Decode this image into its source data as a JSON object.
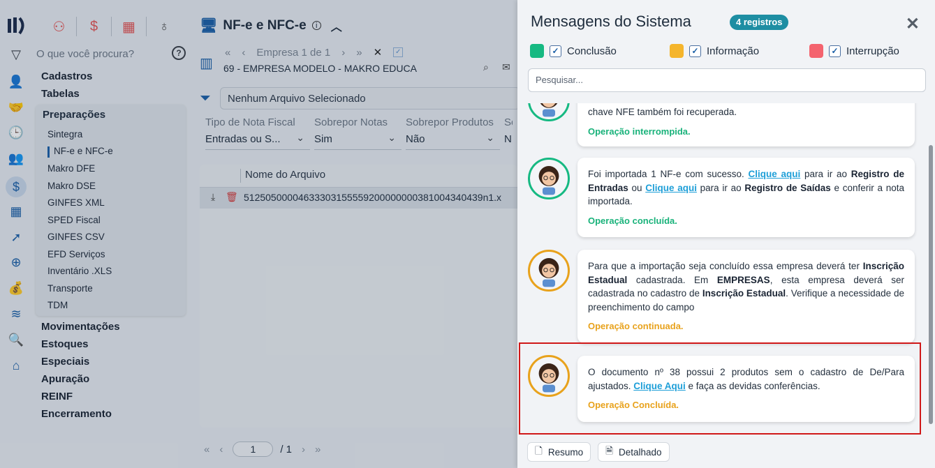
{
  "sidebar": {
    "search_placeholder": "O que você procura?",
    "help": "?",
    "menu_top": [
      "Cadastros",
      "Tabelas"
    ],
    "submenu": {
      "header": "Preparações",
      "items": [
        "Sintegra",
        "NF-e e NFC-e",
        "Makro DFE",
        "Makro DSE",
        "GINFES XML",
        "SPED Fiscal",
        "GINFES CSV",
        "EFD Serviços",
        "Inventário .XLS",
        "Transporte",
        "TDM"
      ],
      "selected": "NF-e e NFC-e"
    },
    "menu_bottom": [
      "Movimentações",
      "Estoques",
      "Especiais",
      "Apuração",
      "REINF",
      "Encerramento"
    ]
  },
  "main": {
    "title": "NF-e e NFC-e",
    "nav_empresa": "Empresa 1 de 1",
    "empresa": "69 - EMPRESA MODELO - MAKRO EDUCA",
    "file_selector": "Nenhum Arquivo Selecionado",
    "fields": [
      {
        "label": "Tipo de Nota Fiscal",
        "value": "Entradas ou S..."
      },
      {
        "label": "Sobrepor Notas",
        "value": "Sim"
      },
      {
        "label": "Sobrepor Produtos",
        "value": "Não"
      },
      {
        "label": "So",
        "value": "N"
      }
    ],
    "grid_header": "Nome do Arquivo",
    "grid_row": "51250500004633303155559200000000381004340439n1.x",
    "pager_page": "1",
    "pager_total": "/ 1"
  },
  "panel": {
    "title": "Mensagens do Sistema",
    "badge": "4 registros",
    "legend": [
      {
        "label": "Conclusão",
        "color": "#16b982"
      },
      {
        "label": "Informação",
        "color": "#f5b52c"
      },
      {
        "label": "Interrupção",
        "color": "#f4636e"
      }
    ],
    "search_placeholder": "Pesquisar...",
    "messages": [
      {
        "text_parts": [
          "chave NFE também foi recuperada."
        ],
        "status": "Operação interrompida."
      },
      {
        "t1": "Foi importada 1 NF-e com sucesso. ",
        "link1": "Clique aqui",
        "t2": " para ir ao ",
        "b1": "Registro de Entradas",
        "t3": " ou ",
        "link2": "Clique aqui",
        "t4": " para ir ao ",
        "b2": "Registro de Saídas",
        "t5": " e conferir a nota importada.",
        "status": "Operação concluída."
      },
      {
        "t1": "Para que a importação seja concluído essa empresa deverá ter ",
        "b1": "Inscrição Estadual",
        "t2": " cadastrada. Em ",
        "b2": "EMPRESAS",
        "t3": ", esta empresa deverá ser cadastrada no cadastro de ",
        "b3": "Inscrição Estadual",
        "t4": ". Verifique a necessidade de preenchimento do campo",
        "status": "Operação continuada."
      },
      {
        "t1": "O documento nº 38 possui 2 produtos sem o cadastro de De/Para ajustados. ",
        "link1": "Clique Aqui",
        "t2": " e faça as devidas conferências.",
        "status": "Operação Concluída."
      }
    ],
    "btn_resumo": "Resumo",
    "btn_detalhado": "Detalhado"
  }
}
